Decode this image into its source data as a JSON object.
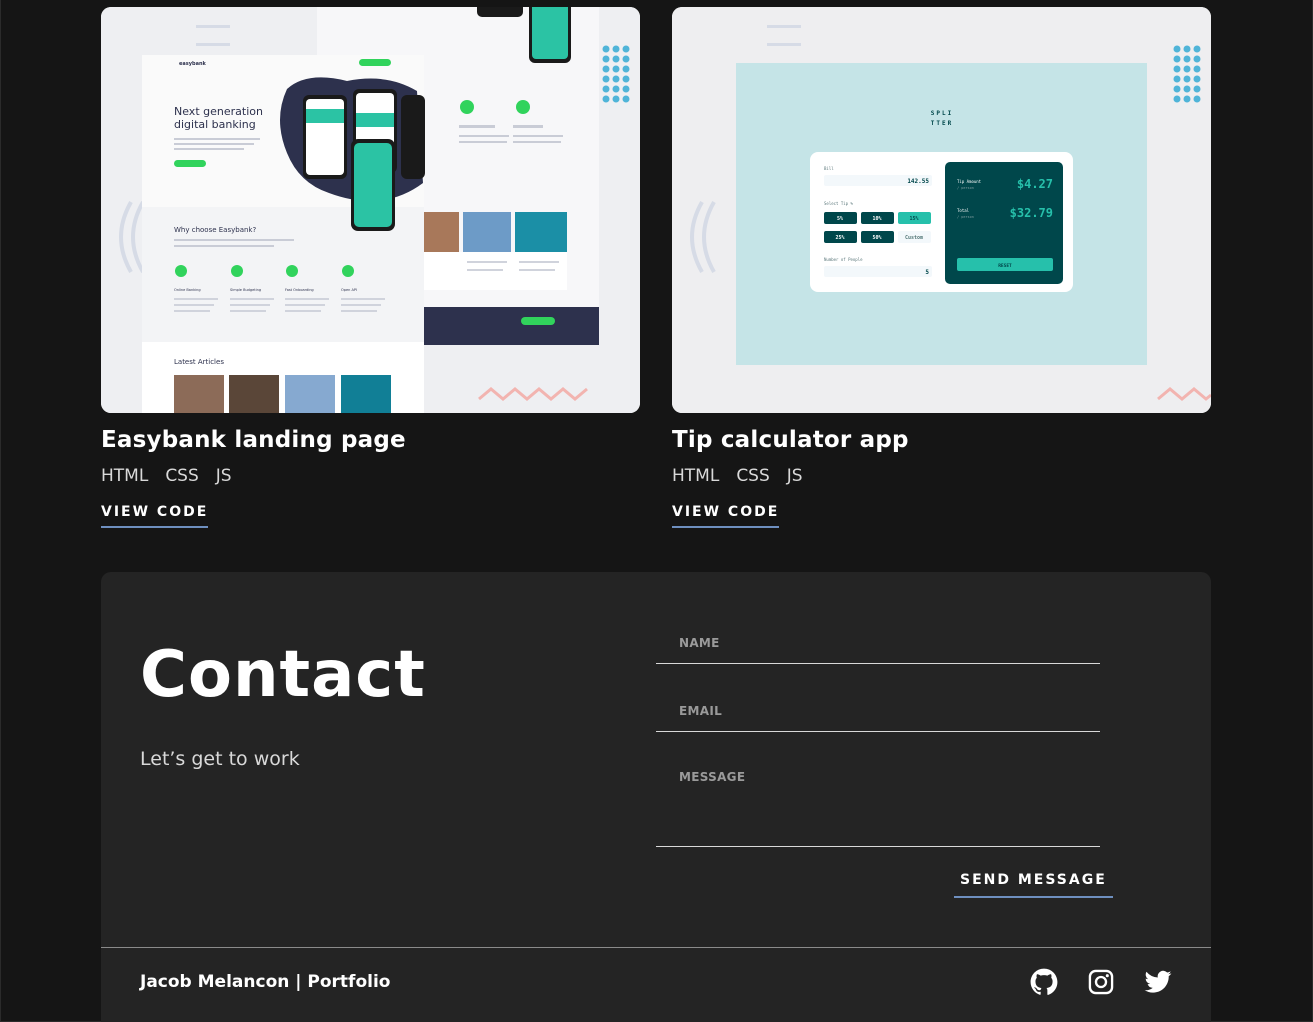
{
  "projects": [
    {
      "title": "Easybank landing page",
      "tags": [
        "HTML",
        "CSS",
        "JS"
      ],
      "link": "VIEW CODE",
      "thumb": {
        "logo": "easybank",
        "headline1": "Next generation",
        "headline2": "digital banking",
        "section": "Why choose Easybank?",
        "features": [
          "Online Banking",
          "Simple Budgeting",
          "Fast Onboarding",
          "Open API"
        ],
        "articles": "Latest Articles"
      }
    },
    {
      "title": "Tip calculator app",
      "tags": [
        "HTML",
        "CSS",
        "JS"
      ],
      "link": "VIEW CODE",
      "thumb": {
        "logo1": "SPLI",
        "logo2": "TTER",
        "bill_label": "Bill",
        "bill_value": "142.55",
        "select_tip": "Select Tip %",
        "tips": [
          "5%",
          "10%",
          "15%",
          "25%",
          "50%",
          "Custom"
        ],
        "people_label": "Number of People",
        "people_value": "5",
        "tip_amount_label": "Tip Amount",
        "per_person": "/ person",
        "tip_amount": "$4.27",
        "total_label": "Total",
        "total": "$32.79",
        "reset": "RESET"
      }
    }
  ],
  "contact": {
    "heading": "Contact",
    "subheading": "Let’s get to work",
    "name_placeholder": "NAME",
    "email_placeholder": "EMAIL",
    "message_placeholder": "MESSAGE",
    "send_label": "SEND MESSAGE"
  },
  "footer": {
    "name": "Jacob Melancon | Portfolio",
    "icons": [
      "github-icon",
      "instagram-icon",
      "twitter-icon"
    ]
  },
  "colors": {
    "accent_underline": "#6e8fbf",
    "background": "#151515",
    "panel": "#242424",
    "easybank_green": "#31d35c",
    "splitter_teal": "#26c0ab",
    "splitter_dark": "#00474b"
  }
}
